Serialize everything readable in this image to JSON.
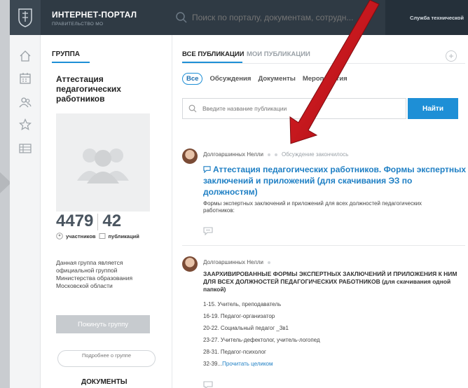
{
  "header": {
    "brand_title": "ИНТЕРНЕТ-ПОРТАЛ",
    "brand_subtitle": "ПРАВИТЕЛЬСТВО МО",
    "search_placeholder": "Поиск по порталу, документам, сотрудн...",
    "support_label": "Служба технической"
  },
  "rail": {
    "icons": [
      "home-icon",
      "calendar-icon",
      "people-icon",
      "star-icon",
      "list-icon"
    ]
  },
  "group": {
    "heading": "ГРУППА",
    "name": "Аттестация педагогических работников",
    "members_count": "4479",
    "publications_count": "42",
    "members_label": "участников",
    "publications_label": "публикаций",
    "description": "Данная группа является официальной группой Министерства образования Московской области",
    "leave_button": "Покинуть группу",
    "more_button": "Подробнее о группе",
    "documents_heading": "ДОКУМЕНТЫ"
  },
  "main": {
    "tab_all": "ВСЕ ПУБЛИКАЦИИ",
    "tab_mine": "МОИ ПУБЛИКАЦИИ",
    "filters": {
      "all": "Все",
      "discussions": "Обсуждения",
      "documents": "Документы",
      "events": "Мероприятия"
    },
    "search_placeholder": "Введите название публикации",
    "find_button": "Найти"
  },
  "posts": [
    {
      "author": "Долгоаршинных Нелли",
      "status": "Обсуждение закончилось",
      "title": "Аттестация педагогических работников. Формы экспертных заключений и приложений (для скачивания ЭЗ по должностям)",
      "text": "Формы экспертных заключений и приложений для всех должностей педагогических работников:"
    },
    {
      "author": "Долгоаршинных Нелли",
      "title": "ЗААРХИВИРОВАННЫЕ ФОРМЫ ЭКСПЕРТНЫХ ЗАКЛЮЧЕНИЙ И ПРИЛОЖЕНИЯ К НИМ ДЛЯ ВСЕХ ДОЛЖНОСТЕЙ ПЕДАГОГИЧЕСКИХ РАБОТНИКОВ (для скачивания одной папкой)",
      "lines": [
        "1-15. Учитель, преподаватель",
        "16-19. Педагог-организатор",
        "20-22. Социальный педагог _3в1",
        "23-27. Учитель-дефектолог, учитель-логопед",
        "28-31. Педагог-психолог"
      ],
      "last_line_prefix": "32-39...",
      "read_more": "Прочитать целиком"
    }
  ],
  "colors": {
    "header_bg": "#2f3a44",
    "accent": "#1e8fd6",
    "arrow": "#c0151b"
  }
}
